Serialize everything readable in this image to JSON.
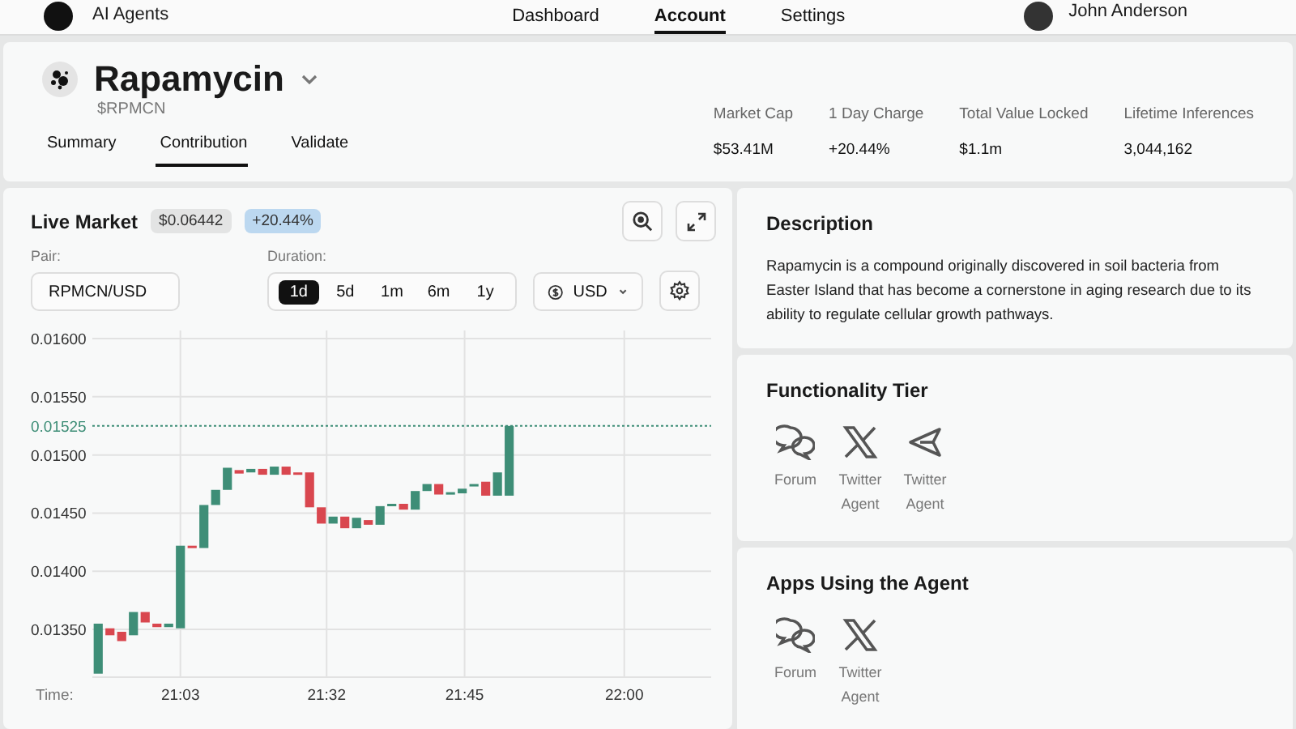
{
  "nav": {
    "brand": "AI Agents",
    "links": [
      {
        "label": "Dashboard",
        "selected": false
      },
      {
        "label": "Account",
        "selected": true
      },
      {
        "label": "Settings",
        "selected": false
      }
    ],
    "user": "John Anderson"
  },
  "token": {
    "name": "Rapamycin",
    "ticker": "$RPMCN"
  },
  "tabs": [
    {
      "label": "Summary",
      "selected": false
    },
    {
      "label": "Contribution",
      "selected": true
    },
    {
      "label": "Validate",
      "selected": false
    }
  ],
  "stats": [
    {
      "label": "Market Cap",
      "value": "$53.41M"
    },
    {
      "label": "1 Day Charge",
      "value": "+20.44%"
    },
    {
      "label": "Total Value Locked",
      "value": "$1.1m"
    },
    {
      "label": "Lifetime Inferences",
      "value": "3,044,162"
    }
  ],
  "market": {
    "title": "Live Market",
    "price": "$0.06442",
    "change": "+20.44%",
    "pair": {
      "label": "Pair:",
      "value": "RPMCN/USD"
    },
    "duration": {
      "label": "Duration:",
      "options": [
        {
          "label": "1d",
          "selected": true
        },
        {
          "label": "5d",
          "selected": false
        },
        {
          "label": "1m",
          "selected": false
        },
        {
          "label": "6m",
          "selected": false
        },
        {
          "label": "1y",
          "selected": false
        }
      ]
    },
    "currency": "USD",
    "chart": {
      "price_labels": [
        "0.01600",
        "0.01550",
        "0.01500",
        "0.01450",
        "0.01400",
        "0.01350"
      ],
      "current_price": "0.01525",
      "time_title": "Time:",
      "time_labels": [
        "21:03",
        "21:32",
        "21:45",
        "22:00"
      ]
    }
  },
  "description": {
    "title": "Description",
    "text": "Rapamycin is a compound originally discovered in soil bacteria from Easter Island that has become a cornerstone in aging research due to its ability to regulate cellular growth pathways."
  },
  "functionality": {
    "title": "Functionality Tier",
    "items": [
      {
        "kind": "forum",
        "label": "Forum"
      },
      {
        "kind": "x",
        "label": "Twitter Agent"
      },
      {
        "kind": "telegram",
        "label": "Twitter Agent"
      }
    ]
  },
  "apps": {
    "title": "Apps Using the Agent",
    "items": [
      {
        "kind": "forum",
        "label": "Forum"
      },
      {
        "kind": "x",
        "label": "Twitter Agent"
      }
    ]
  }
}
